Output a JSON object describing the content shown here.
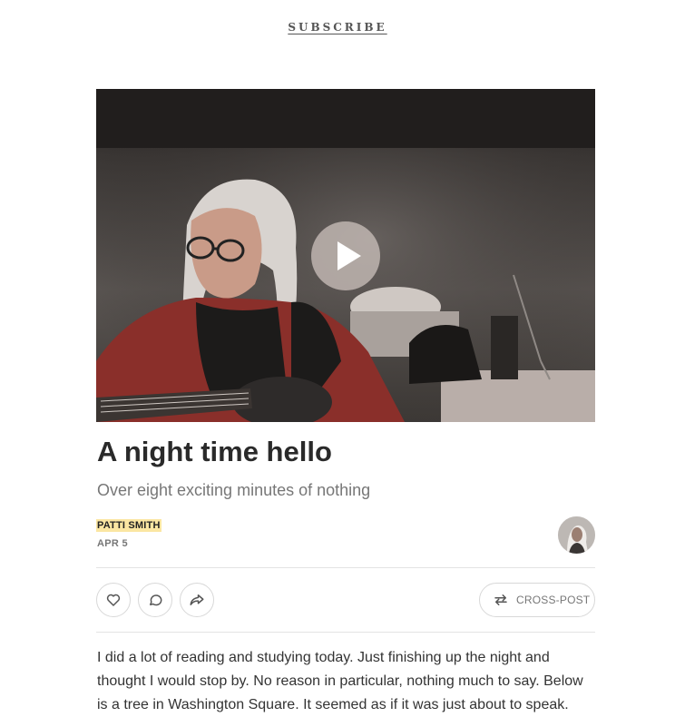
{
  "header": {
    "subscribe_label": "SUBSCRIBE"
  },
  "video": {
    "play_icon": "play-icon"
  },
  "post": {
    "title": "A night time hello",
    "subtitle": "Over eight exciting minutes of nothing",
    "author": "PATTI SMITH",
    "date": "APR 5",
    "body": "I did a lot of reading and studying today. Just finishing up the night and thought I would stop by. No reason in particular, nothing much to say. Below is a tree in Washington Square. It seemed as if it was just about to speak."
  },
  "actions": {
    "like_icon": "heart-icon",
    "comment_icon": "comment-icon",
    "share_icon": "share-icon",
    "crosspost_icon": "swap-arrows-icon",
    "crosspost_label": "CROSS-POST"
  },
  "colors": {
    "author_highlight": "#fbe6a2",
    "muted_text": "#777777",
    "border": "#d8d8d8"
  }
}
